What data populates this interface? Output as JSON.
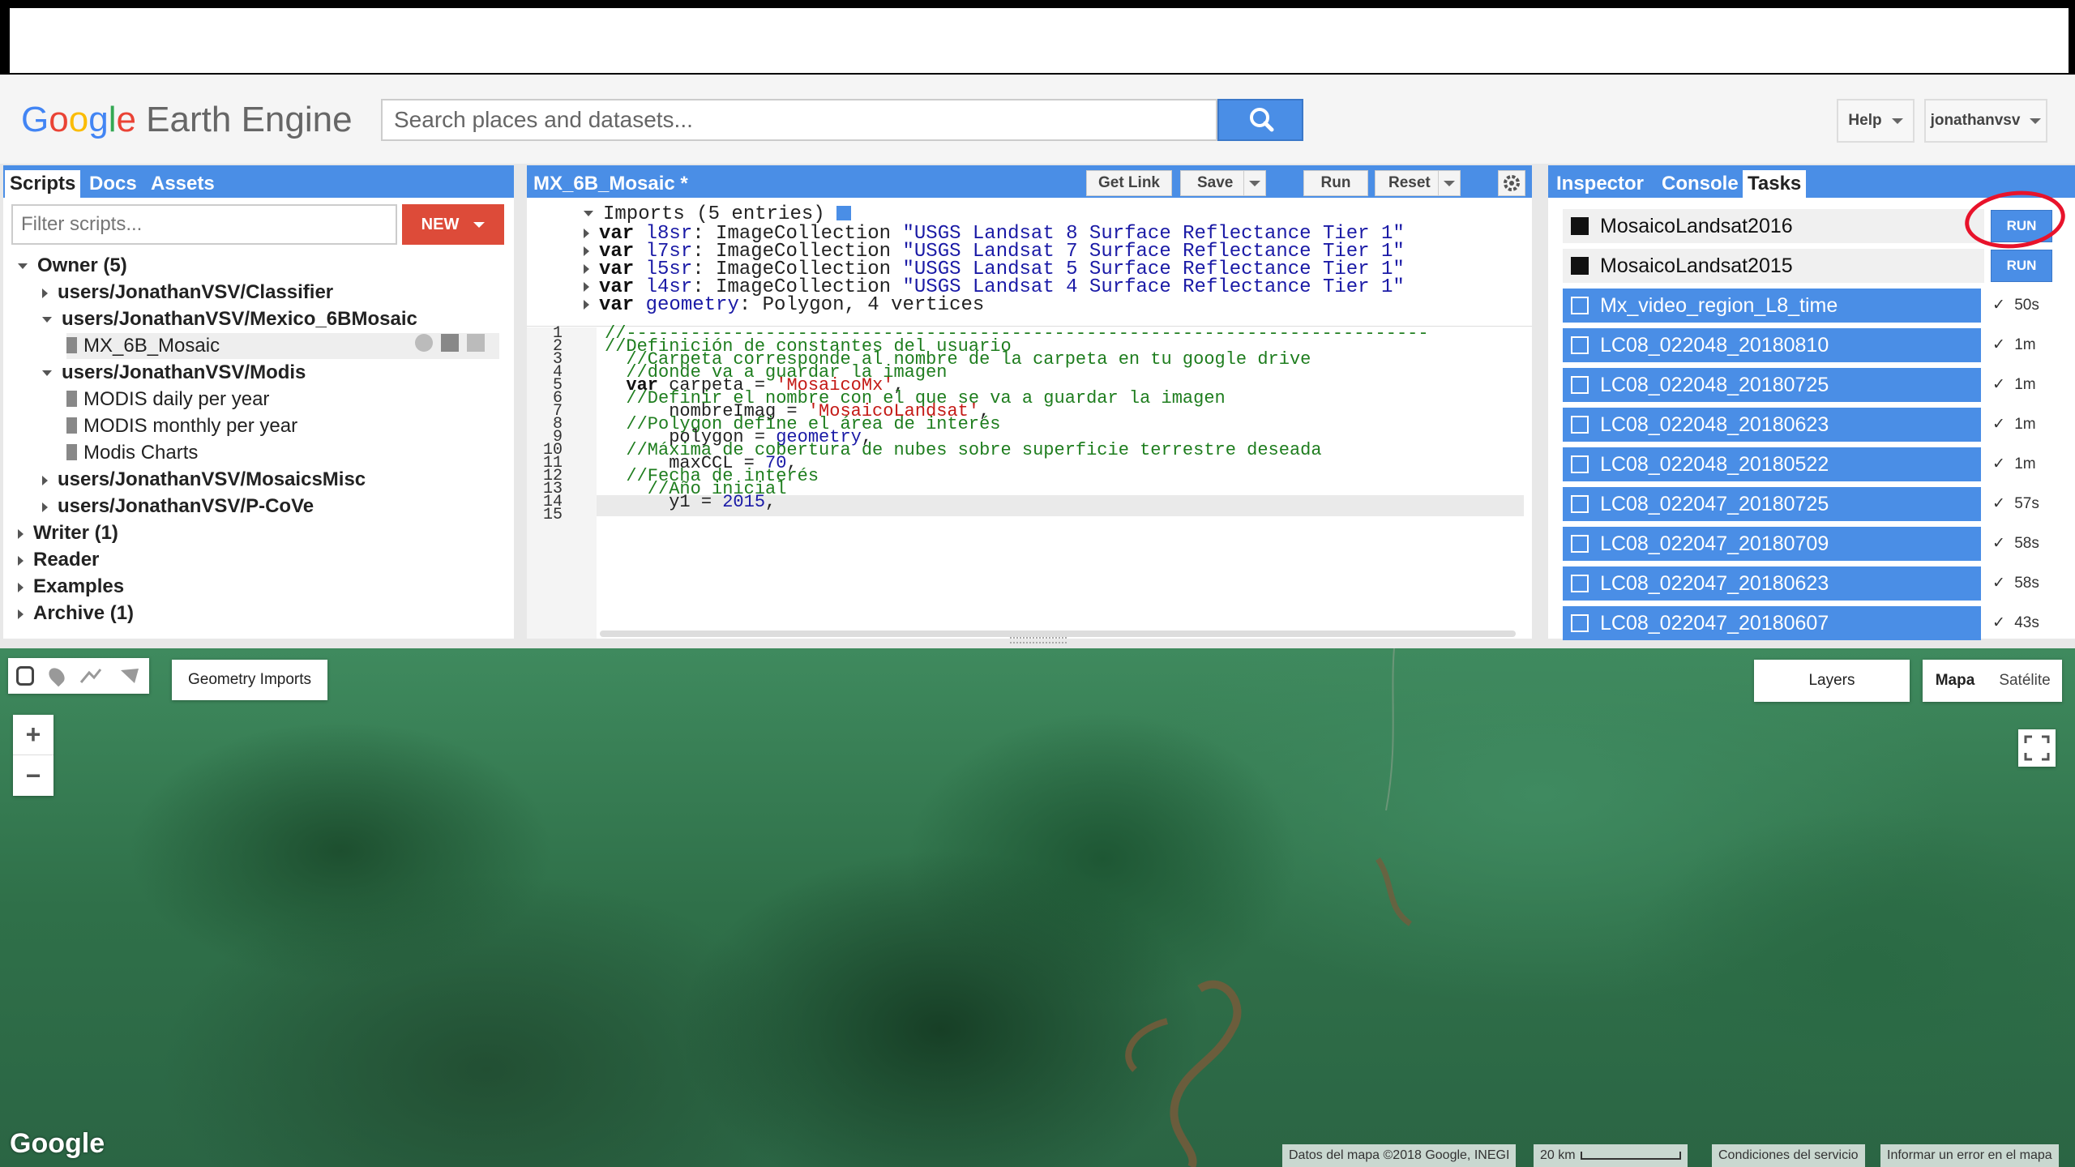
{
  "app": {
    "logo_google": [
      "G",
      "o",
      "o",
      "g",
      "l",
      "e"
    ],
    "logo_rest": " Earth Engine"
  },
  "search": {
    "placeholder": "Search places and datasets..."
  },
  "header": {
    "help_label": "Help",
    "user_label": "jonathanvsv"
  },
  "left_panel": {
    "tabs": [
      "Scripts",
      "Docs",
      "Assets"
    ],
    "filter_placeholder": "Filter scripts...",
    "new_label": "NEW",
    "tree": [
      {
        "label": "Owner  (5)",
        "bold": true,
        "indent": 0,
        "expanded": true
      },
      {
        "label": "users/JonathanVSV/Classifier",
        "bold": true,
        "indent": 1,
        "expanded": false
      },
      {
        "label": "users/JonathanVSV/Mexico_6BMosaic",
        "bold": true,
        "indent": 1,
        "expanded": true
      },
      {
        "label": "MX_6B_Mosaic",
        "bold": false,
        "indent": 2,
        "file": true,
        "selected": true
      },
      {
        "label": "users/JonathanVSV/Modis",
        "bold": true,
        "indent": 1,
        "expanded": true
      },
      {
        "label": "MODIS daily per year",
        "bold": false,
        "indent": 2,
        "file": true
      },
      {
        "label": "MODIS monthly per year",
        "bold": false,
        "indent": 2,
        "file": true
      },
      {
        "label": "Modis Charts",
        "bold": false,
        "indent": 2,
        "file": true
      },
      {
        "label": "users/JonathanVSV/MosaicsMisc",
        "bold": true,
        "indent": 1,
        "expanded": false
      },
      {
        "label": "users/JonathanVSV/P-CoVe",
        "bold": true,
        "indent": 1,
        "expanded": false
      },
      {
        "label": "Writer  (1)",
        "bold": true,
        "indent": 0,
        "expanded": false
      },
      {
        "label": "Reader",
        "bold": true,
        "indent": 0,
        "expanded": false
      },
      {
        "label": "Examples",
        "bold": true,
        "indent": 0,
        "expanded": false
      },
      {
        "label": "Archive  (1)",
        "bold": true,
        "indent": 0,
        "expanded": false
      }
    ]
  },
  "editor": {
    "title": "MX_6B_Mosaic *",
    "buttons": {
      "get_link": "Get Link",
      "save": "Save",
      "run": "Run",
      "reset": "Reset"
    },
    "imports_header": "Imports (5 entries)",
    "imports": [
      {
        "kw": "var",
        "name": "l8sr",
        "rest": ": ImageCollection ",
        "str": "\"USGS Landsat 8 Surface Reflectance Tier 1\""
      },
      {
        "kw": "var",
        "name": "l7sr",
        "rest": ": ImageCollection ",
        "str": "\"USGS Landsat 7 Surface Reflectance Tier 1\""
      },
      {
        "kw": "var",
        "name": "l5sr",
        "rest": ": ImageCollection ",
        "str": "\"USGS Landsat 5 Surface Reflectance Tier 1\""
      },
      {
        "kw": "var",
        "name": "l4sr",
        "rest": ": ImageCollection ",
        "str": "\"USGS Landsat 4 Surface Reflectance Tier 1\""
      },
      {
        "kw": "var",
        "name": "geometry",
        "rest": ": Polygon, 4 vertices",
        "str": ""
      }
    ],
    "line_numbers": [
      "1",
      "2",
      "3",
      "4",
      "5",
      "6",
      "7",
      "8",
      "9",
      "10",
      "11",
      "12",
      "13",
      "14",
      "15"
    ],
    "code_lines": [
      "//---------------------------------------------------------------------------",
      "//Definición de constantes del usuario",
      "  //Carpeta corresponde al nombre de la carpeta en tu google drive",
      "  //donde va a guardar la imagen",
      "  var carpeta = 'MosaicoMx',",
      "  //Definir el nombre con el que se va a guardar la imagen",
      "      nombreImag = 'MosaicoLandsat',",
      "  //Polygon define el área de interés",
      "      polygon = geometry,",
      "  //Máxima de cobertura de nubes sobre superficie terrestre deseada",
      "      maxCCL = 70,",
      "  //Fecha de interés",
      "    //Año inicial",
      "      y1 = 2015,",
      ""
    ]
  },
  "right_panel": {
    "tabs": [
      "Inspector",
      "Console",
      "Tasks"
    ],
    "pending_tasks": [
      {
        "name": "MosaicoLandsat2016",
        "action": "RUN"
      },
      {
        "name": "MosaicoLandsat2015",
        "action": "RUN"
      }
    ],
    "completed_tasks": [
      {
        "name": "Mx_video_region_L8_time",
        "time": "50s"
      },
      {
        "name": "LC08_022048_20180810",
        "time": "1m"
      },
      {
        "name": "LC08_022048_20180725",
        "time": "1m"
      },
      {
        "name": "LC08_022048_20180623",
        "time": "1m"
      },
      {
        "name": "LC08_022048_20180522",
        "time": "1m"
      },
      {
        "name": "LC08_022047_20180725",
        "time": "57s"
      },
      {
        "name": "LC08_022047_20180709",
        "time": "58s"
      },
      {
        "name": "LC08_022047_20180623",
        "time": "58s"
      },
      {
        "name": "LC08_022047_20180607",
        "time": "43s"
      }
    ]
  },
  "map": {
    "geometry_imports_label": "Geometry Imports",
    "layers_label": "Layers",
    "map_type_options": [
      "Mapa",
      "Satélite"
    ],
    "zoom_in": "+",
    "zoom_out": "−",
    "google_watermark": "Google",
    "attribution": "Datos del mapa ©2018 Google, INEGI",
    "scale": "20 km",
    "terms": "Condiciones del servicio",
    "report": "Informar un error en el mapa"
  },
  "colors": {
    "accent": "#4a8ee6",
    "new_button": "#dd4b39",
    "annotation": "#e8132b"
  }
}
